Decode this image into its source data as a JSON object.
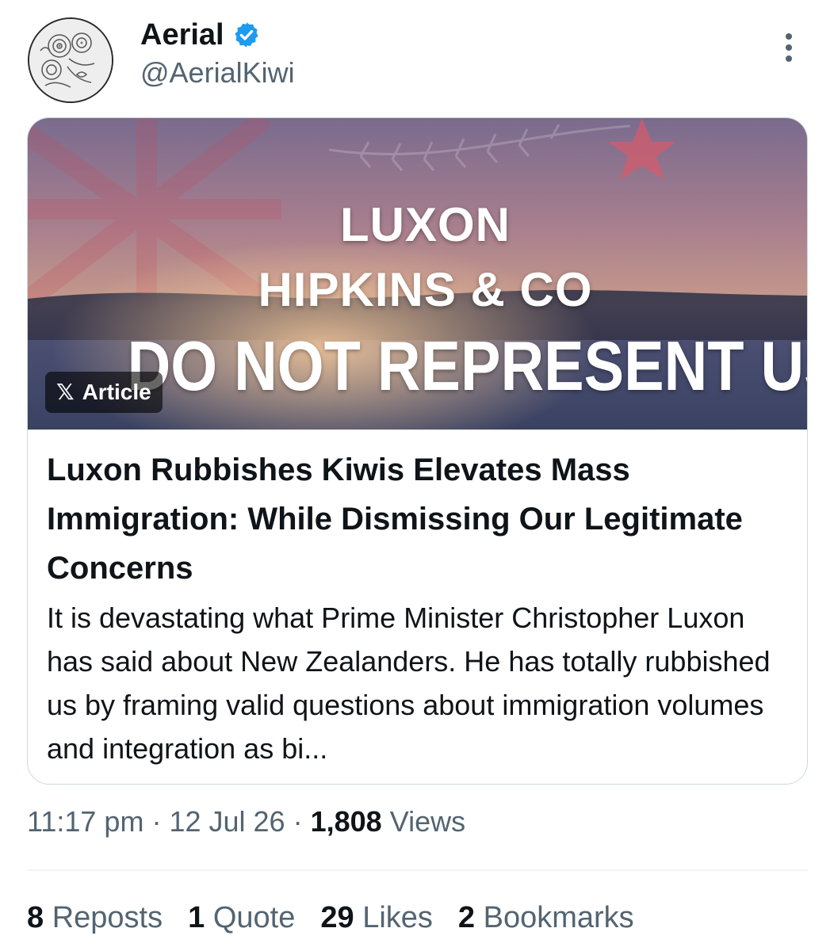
{
  "tweet": {
    "author": {
      "display_name": "Aerial",
      "handle": "@AerialKiwi",
      "verified_icon": "verified-badge-icon",
      "verified_color": "#1d9bf0"
    },
    "more_icon": "more-vertical-icon",
    "article_card": {
      "banner": {
        "line1": "LUXON",
        "line2": "HIPKINS & CO",
        "line3": "DO NOT REPRESENT US",
        "badge_icon": "𝕏",
        "badge_label": "Article"
      },
      "title": "Luxon Rubbishes Kiwis Elevates Mass Immigration: While Dismissing Our Legitimate Concerns",
      "snippet": "It is devastating what Prime Minister Christopher Luxon has said about New Zealanders. He has totally rubbished us by framing valid questions about immigration volumes and integration as bi..."
    },
    "meta": {
      "time": "11:17 pm",
      "separator": "·",
      "date": "12 Jul 26",
      "views_count": "1,808",
      "views_label": "Views"
    },
    "stats": [
      {
        "count": "8",
        "label": "Reposts"
      },
      {
        "count": "1",
        "label": "Quote"
      },
      {
        "count": "29",
        "label": "Likes"
      },
      {
        "count": "2",
        "label": "Bookmarks"
      }
    ]
  },
  "colors": {
    "text_primary": "#0f1419",
    "text_secondary": "#536471",
    "border": "#cfd9de"
  }
}
